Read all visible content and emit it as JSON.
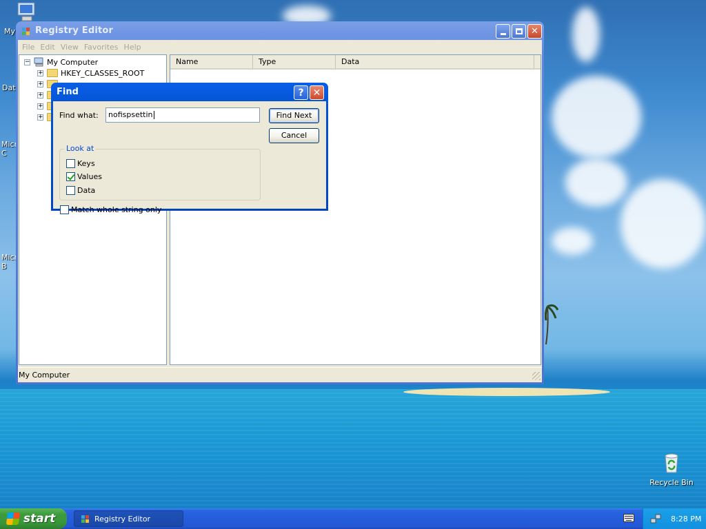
{
  "desktop": {
    "icons_left": [
      "My",
      "Dat",
      "Micro C",
      "Micro B"
    ],
    "recycle_bin": "Recycle Bin"
  },
  "window": {
    "title": "Registry Editor",
    "menu": [
      "File",
      "Edit",
      "View",
      "Favorites",
      "Help"
    ],
    "tree": {
      "root": "My Computer",
      "items": [
        "HKEY_CLASSES_ROOT"
      ]
    },
    "columns": [
      "Name",
      "Type",
      "Data"
    ],
    "status": "My Computer"
  },
  "find_dialog": {
    "title": "Find",
    "help_glyph": "?",
    "find_what_label": "Find what:",
    "find_what_value": "nofispsettin",
    "find_next_label": "Find Next",
    "cancel_label": "Cancel",
    "look_at_label": "Look at",
    "options": [
      {
        "label": "Keys",
        "checked": false
      },
      {
        "label": "Values",
        "checked": true
      },
      {
        "label": "Data",
        "checked": false
      }
    ],
    "match_whole_label": "Match whole string only",
    "match_whole_checked": false
  },
  "taskbar": {
    "start_label": "start",
    "task_item": "Registry Editor",
    "clock": "8:28 PM"
  },
  "colors": {
    "title_blue": "#0352d1",
    "dialog_face": "#ece9d8",
    "start_green": "#3c9a3c",
    "group_label_blue": "#0046d5"
  }
}
